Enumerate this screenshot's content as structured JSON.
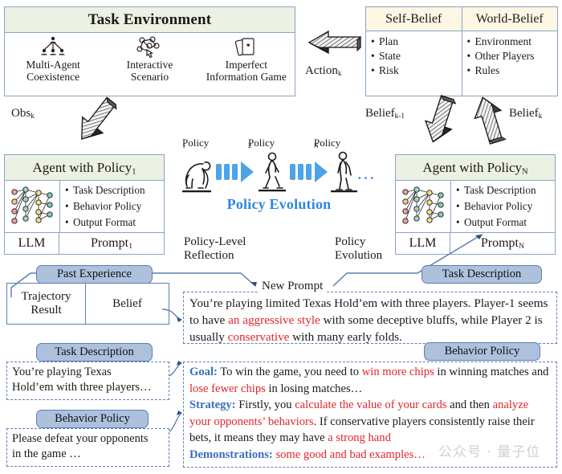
{
  "task_environment": {
    "title": "Task Environment",
    "cells": [
      {
        "icon": "multi-agent-network-icon",
        "line1": "Multi-Agent",
        "line2": "Coexistence"
      },
      {
        "icon": "interactive-cursor-network-icon",
        "line1": "Interactive",
        "line2": "Scenario"
      },
      {
        "icon": "playing-cards-icon",
        "line1": "Imperfect",
        "line2": "Information Game"
      }
    ]
  },
  "belief_table": {
    "columns": [
      "Self-Belief",
      "World-Belief"
    ],
    "self_items": [
      "Plan",
      "State",
      "Risk"
    ],
    "world_items": [
      "Environment",
      "Other Players",
      "Rules"
    ]
  },
  "flow_labels": {
    "action": "Action",
    "action_sub": "k",
    "obs": "Obs",
    "obs_sub": "k",
    "belief_prev": "Belief",
    "belief_prev_sub": "k-1",
    "belief_cur": "Belief",
    "belief_cur_sub": "k",
    "policy_level_reflection_l1": "Policy-Level",
    "policy_level_reflection_l2": "Reflection",
    "policy_evolution_l1": "Policy",
    "policy_evolution_l2": "Evolution",
    "new_prompt": "New Prompt"
  },
  "agent_left": {
    "title": "Agent with Policy",
    "title_sub": "1",
    "nn_icon": "neural-network-icon",
    "items": [
      "Task Description",
      "Behavior Policy",
      "Output Format"
    ],
    "llm": "LLM",
    "prompt": "Prompt",
    "prompt_sub": "1"
  },
  "agent_right": {
    "title": "Agent with Policy",
    "title_sub": "N",
    "nn_icon": "neural-network-icon",
    "items": [
      "Task Description",
      "Behavior Policy",
      "Output Format"
    ],
    "llm": "LLM",
    "prompt": "Prompt",
    "prompt_sub": "N"
  },
  "policy_evolution": {
    "title": "Policy Evolution",
    "title_color": "#2e86de",
    "stage_labels": [
      {
        "text": "Policy",
        "sub": "1"
      },
      {
        "text": "Policy",
        "sub": "2"
      },
      {
        "text": "Policy",
        "sub": "N"
      }
    ],
    "icons": [
      "ape-icon",
      "arrow-chevron-icon",
      "walking-human-icon",
      "arrow-chevron-icon",
      "standing-human-icon"
    ],
    "ellipsis": "···"
  },
  "past_experience": {
    "pill": "Past Experience",
    "cell_trajectory_l1": "Trajectory",
    "cell_trajectory_l2": "Result",
    "cell_belief": "Belief"
  },
  "prompt_small_task_description": {
    "pill": "Task Description",
    "line1": "You’re playing Texas",
    "line2": "Hold’em with three players…"
  },
  "prompt_small_behavior_policy": {
    "pill": "Behavior Policy",
    "line1": "Please defeat your opponents",
    "line2": "in the game …"
  },
  "prompt_big_task_description": {
    "pill": "Task Description",
    "segments": [
      {
        "t": "You’re playing limited Texas Hold’em with three players. Player-1 seems to have ",
        "style": "plain"
      },
      {
        "t": "an aggressive style",
        "style": "red"
      },
      {
        "t": " with some deceptive bluffs, while Player 2 is usually ",
        "style": "plain"
      },
      {
        "t": "conservative",
        "style": "red"
      },
      {
        "t": " with many early folds.",
        "style": "plain"
      }
    ]
  },
  "prompt_big_behavior_policy": {
    "pill": "Behavior Policy",
    "segments": [
      {
        "t": "Goal:",
        "style": "blue"
      },
      {
        "t": " To win the game, you need to ",
        "style": "plain"
      },
      {
        "t": "win more chips",
        "style": "red"
      },
      {
        "t": " in winning matches and ",
        "style": "plain"
      },
      {
        "t": "lose fewer chips",
        "style": "red"
      },
      {
        "t": " in losing matches…",
        "style": "plain"
      },
      {
        "t": "BR",
        "style": "br"
      },
      {
        "t": "Strategy:",
        "style": "blue"
      },
      {
        "t": " Firstly, you ",
        "style": "plain"
      },
      {
        "t": "calculate the value of your cards",
        "style": "red"
      },
      {
        "t": " and then ",
        "style": "plain"
      },
      {
        "t": "analyze your opponents’ behaviors",
        "style": "red"
      },
      {
        "t": ". If conservative players consistently raise their bets, it means they may have ",
        "style": "plain"
      },
      {
        "t": "a strong hand",
        "style": "red"
      },
      {
        "t": "BR",
        "style": "br"
      },
      {
        "t": "Demonstrations:",
        "style": "blue"
      },
      {
        "t": " ",
        "style": "plain"
      },
      {
        "t": "some good and bad examples…",
        "style": "red"
      }
    ]
  },
  "watermark": {
    "text": "公众号 · 量子位"
  },
  "colors": {
    "panel_border": "#8ba2c4",
    "head_green": "#ecf1e3",
    "head_cream": "#fdf6e3",
    "pill_fill": "#adc1dd",
    "pill_border": "#5c7fb0",
    "accent_blue": "#2e86de",
    "highlight_red": "#e0262b",
    "label_blue": "#3a6fbf"
  }
}
